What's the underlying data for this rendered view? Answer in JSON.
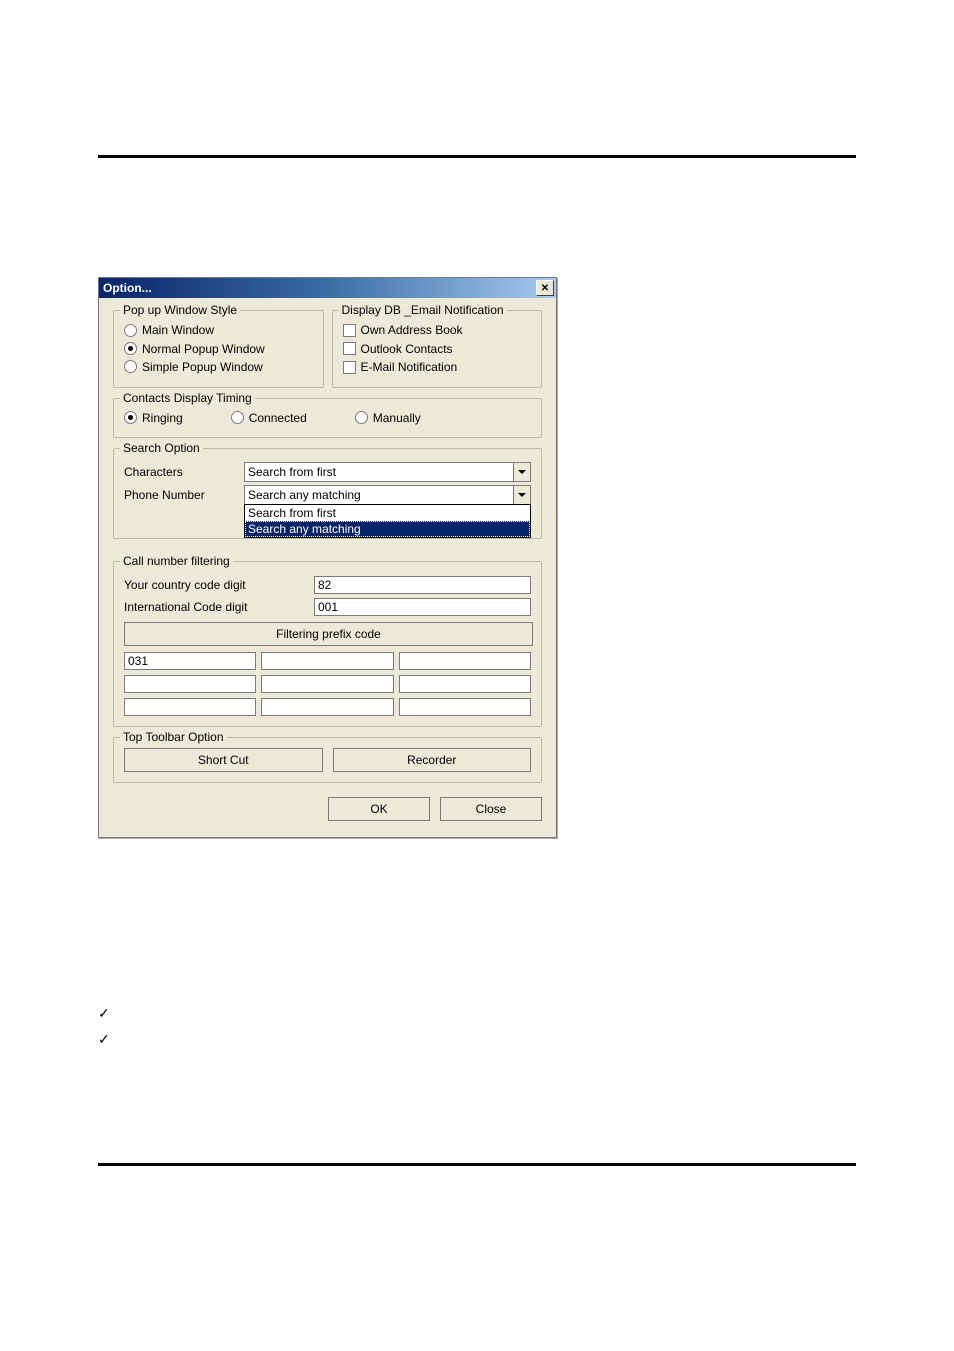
{
  "dialog": {
    "title": "Option...",
    "popup_group": {
      "legend": "Pop up Window Style",
      "options": [
        {
          "label": "Main Window",
          "selected": false
        },
        {
          "label": "Normal Popup Window",
          "selected": true
        },
        {
          "label": "Simple Popup Window",
          "selected": false
        }
      ]
    },
    "display_group": {
      "legend": "Display DB _Email Notification",
      "options": [
        {
          "label": "Own Address Book",
          "checked": false
        },
        {
          "label": "Outlook Contacts",
          "checked": false
        },
        {
          "label": "E-Mail Notification",
          "checked": false
        }
      ]
    },
    "timing_group": {
      "legend": "Contacts Display Timing",
      "options": [
        {
          "label": "Ringing",
          "selected": true
        },
        {
          "label": "Connected",
          "selected": false
        },
        {
          "label": "Manually",
          "selected": false
        }
      ]
    },
    "search_group": {
      "legend": "Search Option",
      "char_label": "Characters",
      "char_value": "Search from first",
      "phone_label": "Phone Number",
      "phone_value": "Search any matching",
      "dropdown_items": [
        {
          "label": "Search from first",
          "selected": false
        },
        {
          "label": "Search any matching",
          "selected": true
        }
      ]
    },
    "callfilter_group": {
      "legend": "Call number filtering",
      "country_label": "Your country code digit",
      "country_value": "82",
      "intl_label": "International Code digit",
      "intl_value": "001",
      "prefix_button": "Filtering prefix code",
      "prefix_values": [
        "031",
        "",
        "",
        "",
        "",
        "",
        "",
        "",
        ""
      ]
    },
    "toolbar_group": {
      "legend": "Top Toolbar Option",
      "shortcut": "Short Cut",
      "recorder": "Recorder"
    },
    "buttons": {
      "ok": "OK",
      "close": "Close"
    }
  },
  "checklist": [
    "",
    ""
  ]
}
